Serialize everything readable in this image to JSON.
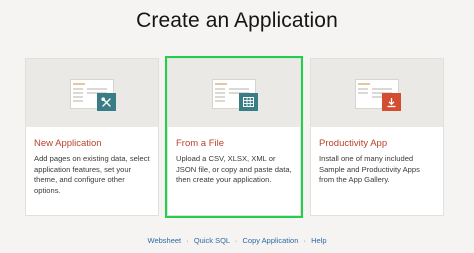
{
  "page": {
    "title": "Create an Application"
  },
  "cards": [
    {
      "title": "New Application",
      "description": "Add pages on existing data, select application features, set your theme, and configure other options.",
      "icon": "tools-icon",
      "accent": "#3a7d86"
    },
    {
      "title": "From a File",
      "description": "Upload a CSV, XLSX, XML or JSON file, or copy and paste data, then create your application.",
      "icon": "table-grid-icon",
      "accent": "#3a7d86",
      "selected": true
    },
    {
      "title": "Productivity App",
      "description": "Install one of many included Sample and Productivity Apps from the App Gallery.",
      "icon": "download-icon",
      "accent": "#d34d33"
    }
  ],
  "footer": {
    "links": [
      "Websheet",
      "Quick SQL",
      "Copy Application",
      "Help"
    ],
    "separator": "·"
  },
  "colors": {
    "selection_outline": "#22d14a",
    "card_title": "#b8432b",
    "link": "#2d6aa3"
  }
}
